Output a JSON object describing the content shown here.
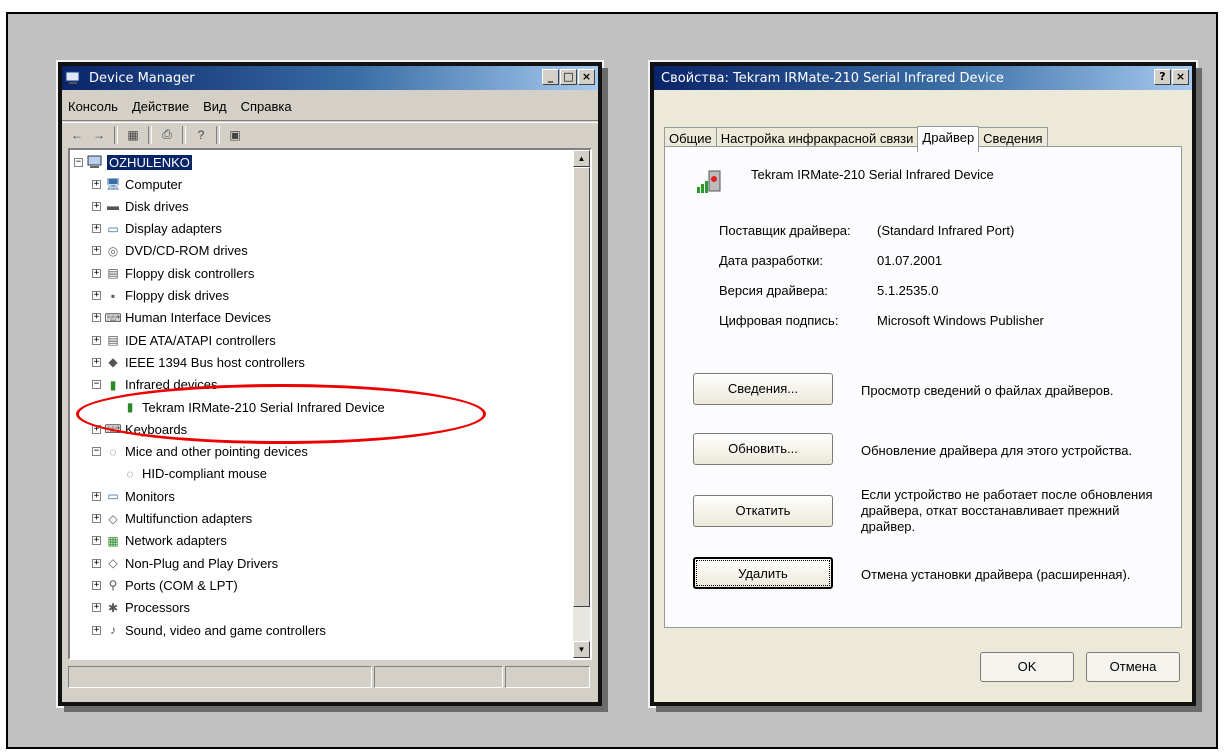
{
  "device_manager": {
    "title": "Device Manager",
    "menu": [
      "Консоль",
      "Действие",
      "Вид",
      "Справка"
    ],
    "root": "OZHULENKO",
    "tree": [
      {
        "label": "Computer",
        "expander": "+",
        "icon": "computer-icon"
      },
      {
        "label": "Disk drives",
        "expander": "+",
        "icon": "disk-drive-icon"
      },
      {
        "label": "Display adapters",
        "expander": "+",
        "icon": "display-adapter-icon"
      },
      {
        "label": "DVD/CD-ROM drives",
        "expander": "+",
        "icon": "cdrom-icon"
      },
      {
        "label": "Floppy disk controllers",
        "expander": "+",
        "icon": "controller-icon"
      },
      {
        "label": "Floppy disk drives",
        "expander": "+",
        "icon": "floppy-icon"
      },
      {
        "label": "Human Interface Devices",
        "expander": "+",
        "icon": "hid-icon"
      },
      {
        "label": "IDE ATA/ATAPI controllers",
        "expander": "+",
        "icon": "ide-icon"
      },
      {
        "label": "IEEE 1394 Bus host controllers",
        "expander": "+",
        "icon": "firewire-icon"
      },
      {
        "label": "Infrared devices",
        "expander": "-",
        "icon": "infrared-icon"
      },
      {
        "label": "Tekram IRMate-210 Serial Infrared Device",
        "expander": "",
        "icon": "infrared-device-icon",
        "child": true
      },
      {
        "label": "Keyboards",
        "expander": "+",
        "icon": "keyboard-icon"
      },
      {
        "label": "Mice and other pointing devices",
        "expander": "-",
        "icon": "mouse-icon"
      },
      {
        "label": "HID-compliant mouse",
        "expander": "",
        "icon": "mouse-icon",
        "child": true
      },
      {
        "label": "Monitors",
        "expander": "+",
        "icon": "monitor-icon"
      },
      {
        "label": "Multifunction adapters",
        "expander": "+",
        "icon": "multifunction-icon"
      },
      {
        "label": "Network adapters",
        "expander": "+",
        "icon": "network-icon"
      },
      {
        "label": "Non-Plug and Play Drivers",
        "expander": "+",
        "icon": "driver-icon"
      },
      {
        "label": "Ports (COM & LPT)",
        "expander": "+",
        "icon": "port-icon"
      },
      {
        "label": "Processors",
        "expander": "+",
        "icon": "processor-icon"
      },
      {
        "label": "Sound, video and game controllers",
        "expander": "+",
        "icon": "sound-icon"
      }
    ]
  },
  "properties": {
    "title": "Свойства: Tekram IRMate-210 Serial Infrared Device",
    "tabs": [
      "Общие",
      "Настройка инфракрасной связи",
      "Драйвер",
      "Сведения"
    ],
    "active_tab": "Драйвер",
    "device_name": "Tekram IRMate-210 Serial Infrared Device",
    "fields": [
      {
        "key": "Поставщик драйвера:",
        "value": "(Standard Infrared Port)"
      },
      {
        "key": "Дата разработки:",
        "value": "01.07.2001"
      },
      {
        "key": "Версия драйвера:",
        "value": "5.1.2535.0"
      },
      {
        "key": "Цифровая подпись:",
        "value": "Microsoft Windows Publisher"
      }
    ],
    "actions": [
      {
        "label": "Сведения...",
        "desc": "Просмотр сведений о файлах драйверов."
      },
      {
        "label": "Обновить...",
        "desc": "Обновление драйвера для этого устройства."
      },
      {
        "label": "Откатить",
        "desc": "Если устройство не работает после обновления драйвера, откат восстанавливает прежний драйвер."
      },
      {
        "label": "Удалить",
        "desc": "Отмена установки драйвера (расширенная)."
      }
    ],
    "ok_label": "OK",
    "cancel_label": "Отмена"
  }
}
